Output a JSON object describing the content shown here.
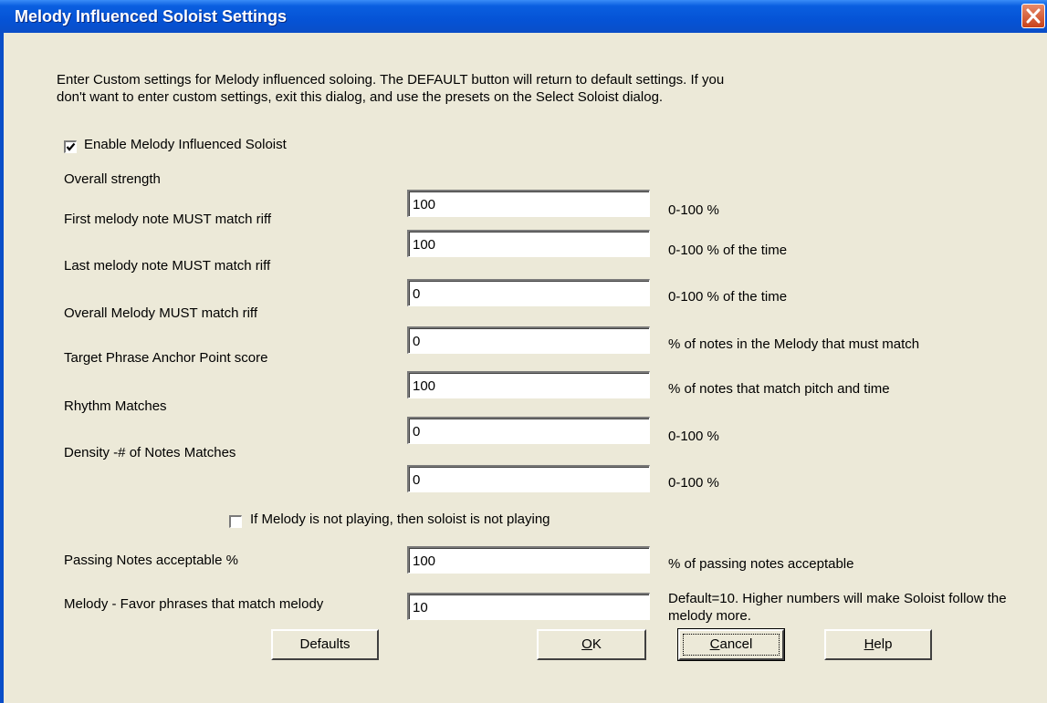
{
  "window": {
    "title": "Melody Influenced Soloist Settings"
  },
  "intro": {
    "line1": "Enter Custom settings for Melody influenced soloing. The DEFAULT button will return to default settings. If you",
    "line2": "don't want to enter custom settings, exit this dialog, and use the presets on the Select Soloist dialog."
  },
  "enable": {
    "label": "Enable Melody Influenced Soloist",
    "checked": true
  },
  "rows": [
    {
      "label": "Overall strength",
      "value": "100",
      "unit": "0-100 %"
    },
    {
      "label": "First melody note MUST match riff",
      "value": "100",
      "unit": "0-100 % of the time"
    },
    {
      "label": "Last melody note MUST match riff",
      "value": "0",
      "unit": "0-100 % of the time"
    },
    {
      "label": "Overall Melody MUST match riff",
      "value": "0",
      "unit": "% of notes in the Melody that must match"
    },
    {
      "label": "Target Phrase Anchor Point score",
      "value": "100",
      "unit": "% of notes that match pitch and time"
    },
    {
      "label": "Rhythm Matches",
      "value": "0",
      "unit": "0-100 %"
    },
    {
      "label": "Density -# of Notes Matches",
      "value": "0",
      "unit": "0-100 %"
    }
  ],
  "melody_not_playing": {
    "label": "If Melody is not playing, then soloist is not playing",
    "checked": false
  },
  "passing": {
    "label": "Passing Notes acceptable %",
    "value": "100",
    "unit": "% of passing notes acceptable"
  },
  "favor": {
    "label": "Melody - Favor phrases that match melody",
    "value": "10",
    "unit_line1": "Default=10. Higher numbers will make Soloist follow the",
    "unit_line2": "melody more."
  },
  "buttons": {
    "defaults": "Defaults",
    "ok_mnemonic": "O",
    "ok_rest": "K",
    "cancel_mnemonic": "C",
    "cancel_rest": "ancel",
    "help_mnemonic": "H",
    "help_rest": "elp"
  },
  "colors": {
    "titlebar": "#0553d6",
    "dialog_bg": "#ece9d8",
    "close_button": "#c8421a"
  },
  "icons": {
    "close": "close-icon",
    "check": "checkmark-icon"
  }
}
